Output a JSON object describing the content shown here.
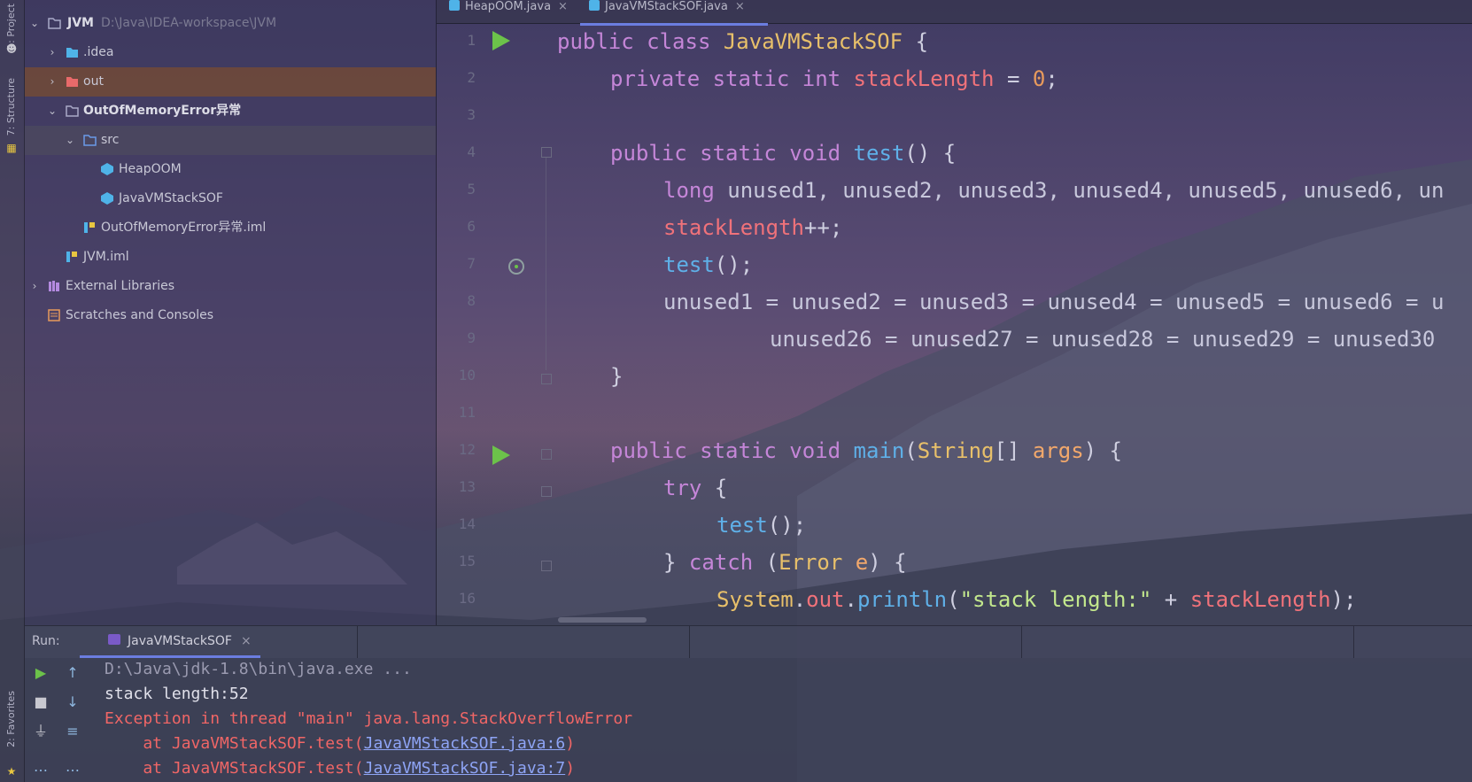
{
  "left_strip": {
    "project_label": "1: Project",
    "structure_label": "7: Structure",
    "favorites_label": "2: Favorites"
  },
  "project_tree": {
    "root": {
      "name": "JVM",
      "path": "D:\\Java\\IDEA-workspace\\JVM"
    },
    "items": [
      {
        "label": ".idea"
      },
      {
        "label": "out"
      },
      {
        "label": "OutOfMemoryError异常"
      },
      {
        "label": "src"
      },
      {
        "label": "HeapOOM"
      },
      {
        "label": "JavaVMStackSOF"
      },
      {
        "label": "OutOfMemoryError异常.iml"
      },
      {
        "label": "JVM.iml"
      },
      {
        "label": "External Libraries"
      },
      {
        "label": "Scratches and Consoles"
      }
    ]
  },
  "editor_tabs": [
    {
      "label": "HeapOOM.java"
    },
    {
      "label": "JavaVMStackSOF.java"
    }
  ],
  "code": {
    "line_numbers": [
      "1",
      "2",
      "3",
      "4",
      "5",
      "6",
      "7",
      "8",
      "9",
      "10",
      "11",
      "12",
      "13",
      "14",
      "15",
      "16"
    ],
    "l1": {
      "kw": "public class ",
      "cls": "JavaVMStackSOF",
      "rest": " {"
    },
    "l2": {
      "kw": "private static int ",
      "fld": "stackLength",
      "eq": " = ",
      "num": "0",
      "end": ";"
    },
    "l4": {
      "kw": "public static void ",
      "fn": "test",
      "rest": "() {"
    },
    "l5": {
      "kw": "long ",
      "rest": "unused1, unused2, unused3, unused4, unused5, unused6, un"
    },
    "l6": {
      "fld": "stackLength",
      "rest": "++;"
    },
    "l7": {
      "fn": "test",
      "rest": "();"
    },
    "l8": {
      "rest": "unused1 = unused2 = unused3 = unused4 = unused5 = unused6 = u"
    },
    "l9": {
      "rest": "unused26 = unused27 = unused28 = unused29 = unused30"
    },
    "l10": {
      "rest": "}"
    },
    "l12": {
      "kw": "public static void ",
      "fn": "main",
      "p1": "(",
      "cls": "String",
      "p2": "[] ",
      "param": "args",
      "rest": ") {"
    },
    "l13": {
      "kw": "try",
      "rest": " {"
    },
    "l14": {
      "fn": "test",
      "rest": "();"
    },
    "l15": {
      "p1": "} ",
      "kw": "catch",
      "p2": " (",
      "cls": "Error",
      "param": " e",
      "rest": ") {"
    },
    "l16": {
      "cls": "System",
      "dot1": ".",
      "out": "out",
      "dot2": ".",
      "fn": "println",
      "p1": "(",
      "str": "\"stack length:\"",
      "plus": " + ",
      "fld": "stackLength",
      "rest": ");"
    }
  },
  "run_panel": {
    "label": "Run:",
    "tab_label": "JavaVMStackSOF",
    "console": {
      "cmd": "D:\\Java\\jdk-1.8\\bin\\java.exe ...",
      "output": "stack length:52",
      "exception": "Exception in thread \"main\" java.lang.StackOverflowError",
      "trace": [
        {
          "prefix": "    at JavaVMStackSOF.test(",
          "link": "JavaVMStackSOF.java:6",
          "suffix": ")"
        },
        {
          "prefix": "    at JavaVMStackSOF.test(",
          "link": "JavaVMStackSOF.java:7",
          "suffix": ")"
        }
      ]
    }
  },
  "colors": {
    "keyword": "#c586d8",
    "class": "#e8c06a",
    "field": "#f0727a",
    "function": "#5fb0e8",
    "string": "#c3e88d",
    "number": "#e89a5c",
    "run_green": "#6cc24a",
    "error_red": "#f06666"
  }
}
